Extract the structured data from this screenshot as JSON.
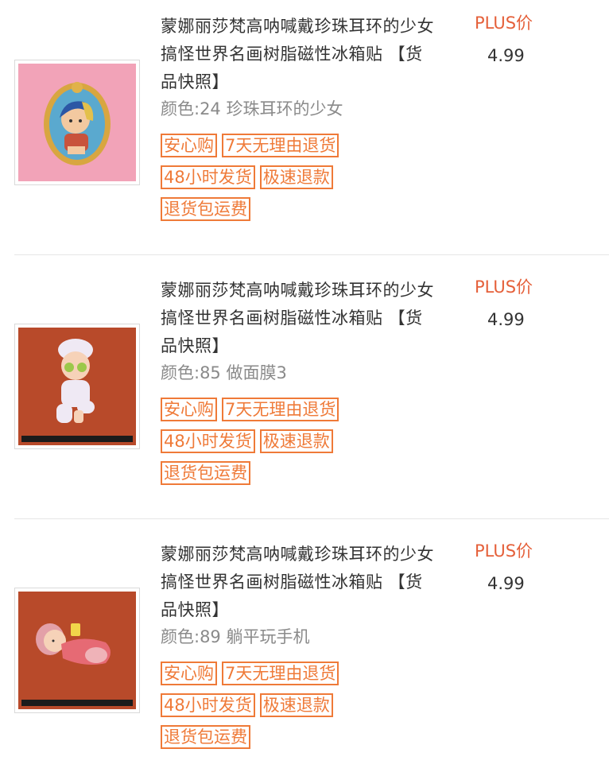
{
  "items": [
    {
      "title": "蒙娜丽莎梵高呐喊戴珍珠耳环的少女搞怪世界名画树脂磁性冰箱贴 【货品快照】",
      "spec": "颜色:24 珍珠耳环的少女",
      "tags": [
        "安心购",
        "7天无理由退货",
        "48小时发货",
        "极速退款",
        "退货包运费"
      ],
      "price_label": "PLUS价",
      "price": "4.99",
      "image_bg": "#f2a3b8"
    },
    {
      "title": "蒙娜丽莎梵高呐喊戴珍珠耳环的少女搞怪世界名画树脂磁性冰箱贴 【货品快照】",
      "spec": "颜色:85 做面膜3",
      "tags": [
        "安心购",
        "7天无理由退货",
        "48小时发货",
        "极速退款",
        "退货包运费"
      ],
      "price_label": "PLUS价",
      "price": "4.99",
      "image_bg": "#b84a2a"
    },
    {
      "title": "蒙娜丽莎梵高呐喊戴珍珠耳环的少女搞怪世界名画树脂磁性冰箱贴 【货品快照】",
      "spec": "颜色:89 躺平玩手机",
      "tags": [
        "安心购",
        "7天无理由退货",
        "48小时发货",
        "极速退款",
        "退货包运费"
      ],
      "price_label": "PLUS价",
      "price": "4.99",
      "image_bg": "#b84a2a"
    }
  ],
  "colors": {
    "accent": "#ef7a38",
    "price_label": "#e5603a",
    "divider": "#e6e6e6"
  }
}
